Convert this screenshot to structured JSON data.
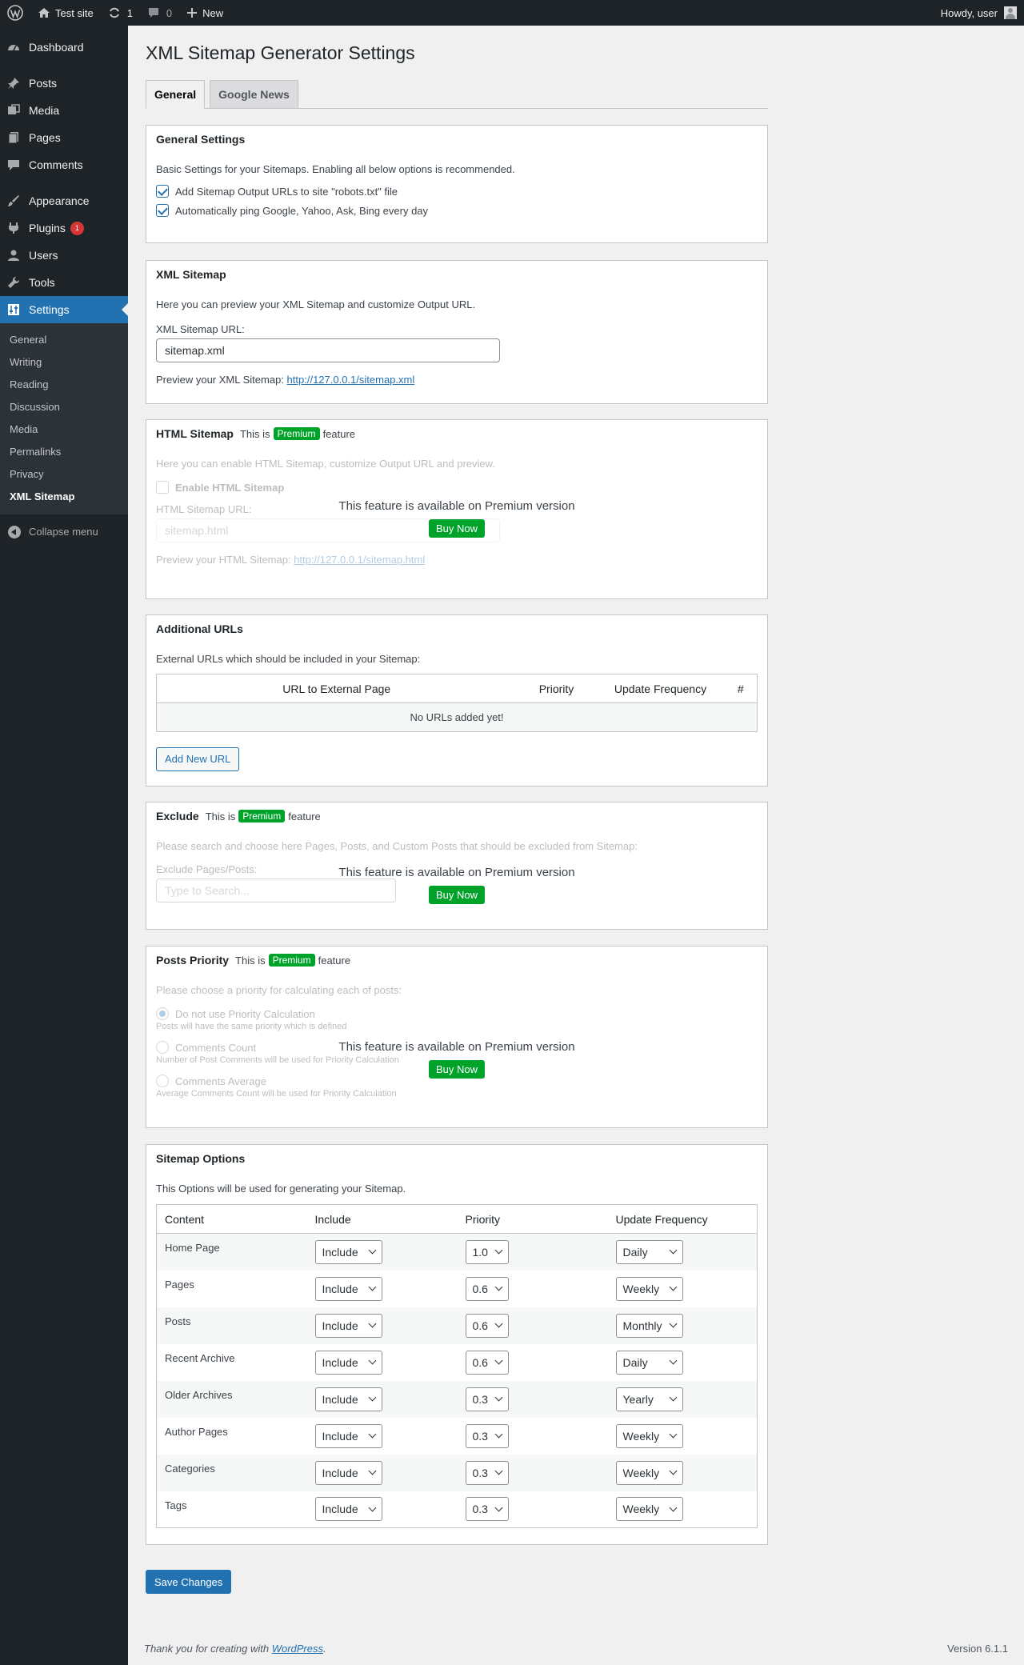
{
  "adminbar": {
    "site_name": "Test site",
    "updates_count": "1",
    "comments_count": "0",
    "new_label": "New",
    "howdy": "Howdy, user"
  },
  "sidebar": {
    "items": [
      {
        "label": "Dashboard",
        "icon": "dashboard-icon"
      },
      {
        "label": "Posts",
        "icon": "pin-icon"
      },
      {
        "label": "Media",
        "icon": "media-icon"
      },
      {
        "label": "Pages",
        "icon": "pages-icon"
      },
      {
        "label": "Comments",
        "icon": "comment-icon"
      },
      {
        "label": "Appearance",
        "icon": "brush-icon"
      },
      {
        "label": "Plugins",
        "icon": "plugin-icon",
        "badge": "1"
      },
      {
        "label": "Users",
        "icon": "users-icon"
      },
      {
        "label": "Tools",
        "icon": "wrench-icon"
      },
      {
        "label": "Settings",
        "icon": "settings-icon"
      }
    ],
    "submenu": [
      "General",
      "Writing",
      "Reading",
      "Discussion",
      "Media",
      "Permalinks",
      "Privacy",
      "XML Sitemap"
    ],
    "collapse_label": "Collapse menu"
  },
  "page": {
    "title": "XML Sitemap Generator Settings",
    "tabs": [
      "General",
      "Google News"
    ]
  },
  "general": {
    "title": "General Settings",
    "description": "Basic Settings for your Sitemaps. Enabling all below options is recommended.",
    "opt1": "Add Sitemap Output URLs to site \"robots.txt\" file",
    "opt2": "Automatically ping Google, Yahoo, Ask, Bing every day"
  },
  "xml": {
    "title": "XML Sitemap",
    "description": "Here you can preview your XML Sitemap and customize Output URL.",
    "url_label": "XML Sitemap URL:",
    "url_value": "sitemap.xml",
    "preview_label": "Preview your XML Sitemap:",
    "preview_link": "http://127.0.0.1/sitemap.xml"
  },
  "premium": {
    "this_is": "This is",
    "badge": "Premium",
    "feature": "feature",
    "message": "This feature is available on Premium version",
    "buy": "Buy Now"
  },
  "html_sitemap": {
    "title": "HTML Sitemap",
    "description": "Here you can enable HTML Sitemap, customize Output URL and preview.",
    "enable_label": "Enable HTML Sitemap",
    "url_label": "HTML Sitemap URL:",
    "url_value": "sitemap.html",
    "preview_label": "Preview your HTML Sitemap:",
    "preview_link": "http://127.0.0.1/sitemap.html"
  },
  "additional": {
    "title": "Additional URLs",
    "description": "External URLs which should be included in your Sitemap:",
    "columns": [
      "URL to External Page",
      "Priority",
      "Update Frequency",
      "#"
    ],
    "empty": "No URLs added yet!",
    "add_button": "Add New URL"
  },
  "exclude": {
    "title": "Exclude",
    "description": "Please search and choose here Pages, Posts, and Custom Posts that should be excluded from Sitemap:",
    "field_label": "Exclude Pages/Posts:",
    "placeholder": "Type to Search..."
  },
  "posts_priority": {
    "title": "Posts Priority",
    "description": "Please choose a priority for calculating each of posts:",
    "options": [
      {
        "label": "Do not use Priority Calculation",
        "note": "Posts will have the same priority which is defined"
      },
      {
        "label": "Comments Count",
        "note": "Number of Post Comments will be used for Priority Calculation"
      },
      {
        "label": "Comments Average",
        "note": "Average Comments Count will be used for Priority Calculation"
      }
    ]
  },
  "sitemap_options": {
    "title": "Sitemap Options",
    "description": "This Options will be used for generating your Sitemap.",
    "columns": [
      "Content",
      "Include",
      "Priority",
      "Update Frequency"
    ],
    "rows": [
      {
        "content": "Home Page",
        "include": "Include",
        "priority": "1.0",
        "frequency": "Daily"
      },
      {
        "content": "Pages",
        "include": "Include",
        "priority": "0.6",
        "frequency": "Weekly"
      },
      {
        "content": "Posts",
        "include": "Include",
        "priority": "0.6",
        "frequency": "Monthly"
      },
      {
        "content": "Recent Archive",
        "include": "Include",
        "priority": "0.6",
        "frequency": "Daily"
      },
      {
        "content": "Older Archives",
        "include": "Include",
        "priority": "0.3",
        "frequency": "Yearly"
      },
      {
        "content": "Author Pages",
        "include": "Include",
        "priority": "0.3",
        "frequency": "Weekly"
      },
      {
        "content": "Categories",
        "include": "Include",
        "priority": "0.3",
        "frequency": "Weekly"
      },
      {
        "content": "Tags",
        "include": "Include",
        "priority": "0.3",
        "frequency": "Weekly"
      }
    ]
  },
  "save_button": "Save Changes",
  "footer": {
    "thanks_prefix": "Thank you for creating with",
    "wordpress_link": "WordPress",
    "thanks_suffix": ".",
    "version": "Version 6.1.1"
  },
  "colors": {
    "admin_dark": "#1d2327",
    "accent": "#2271b1",
    "premium_green": "#00a32a",
    "badge_red": "#d63638"
  }
}
